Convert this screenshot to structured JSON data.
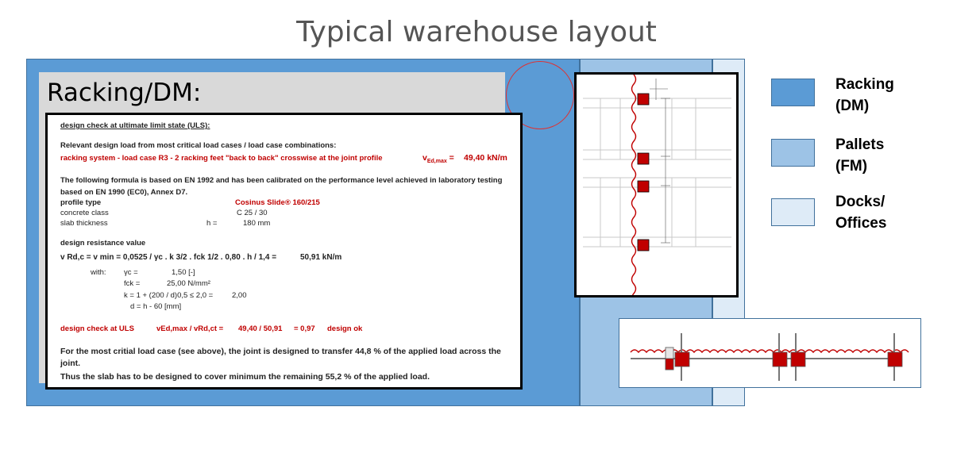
{
  "title": "Typical warehouse layout",
  "panel_title": "Racking/DM:",
  "calc": {
    "heading": "design check at ultimate limit state (ULS):",
    "l1": "Relevant design load from most critical load cases / load case combinations:",
    "l2": "racking system - load case R3 - 2 racking feet \"back to back\" crosswise at the joint profile",
    "v_label": "v",
    "v_sub": "Ed,max",
    "v_eq": " =",
    "v_value": "49,40   kN/m",
    "l3": "The following formula is based on EN 1992 and has been calibrated on the performance level achieved in laboratory testing",
    "l4": "based on EN 1990 (EC0), Annex D7.",
    "profile_label": "profile type",
    "profile_value": "Cosinus Slide® 160/215",
    "concrete_label": "concrete class",
    "concrete_value": "C 25 / 30",
    "slab_label": "slab thickness",
    "slab_h": "h =",
    "slab_value": "180  mm",
    "resistance_label": "design resistance value",
    "formula": "v Rd,c  =  v min  =  0,0525  /  γc .  k 3/2  .  fck 1/2  .  0,80  .  h  /  1,4 =",
    "formula_value": "50,91  kN/m",
    "with": "with:",
    "gamma": "γc =",
    "gamma_value": "1,50  [-]",
    "fck": "fck =",
    "fck_value": "25,00  N/mm²",
    "k_formula": "k = 1 + (200 / d)0,5 ≤ 2,0 =",
    "k_value": "2,00",
    "d_formula": "d = h - 60 [mm]",
    "check_label": "design check at ULS",
    "check_formula": "vEd,max / vRd,ct =",
    "check_values": "49,40  / 50,91",
    "check_result": "= 0,97",
    "check_ok": "design ok",
    "c1": "For the most critial load case (see above), the joint is designed to transfer 44,8 % of the applied load across the",
    "c2": "joint.",
    "c3": "Thus the slab has to be designed to cover minimum the remaining 55,2 % of the applied load."
  },
  "legend": [
    {
      "line1": "Racking",
      "line2": "(DM)",
      "color": "#5b9bd5"
    },
    {
      "line1": "Pallets",
      "line2": "(FM)",
      "color": "#9dc3e6"
    },
    {
      "line1": "Docks/",
      "line2": "Offices",
      "color": "#deebf7"
    }
  ],
  "colors": {
    "racking": "#5b9bd5",
    "pallets": "#9dc3e6",
    "docks": "#deebf7",
    "red": "#c00000"
  }
}
